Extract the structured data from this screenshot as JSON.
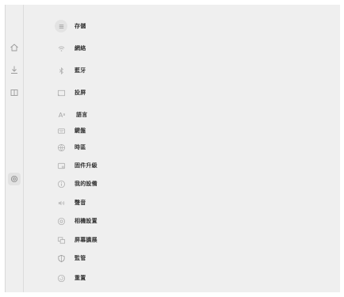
{
  "rail": [
    {
      "icon": "home-icon",
      "active": false
    },
    {
      "icon": "download-icon",
      "active": false
    },
    {
      "icon": "tablet-icon",
      "active": false
    },
    {
      "icon": "gear-icon",
      "active": true
    }
  ],
  "menu": {
    "items": [
      {
        "label": "存儲",
        "icon": "storage-icon"
      },
      {
        "label": "網絡",
        "icon": "wifi-icon"
      },
      {
        "label": "藍牙",
        "icon": "bluetooth-icon"
      },
      {
        "label": "投屏",
        "icon": "screen-cast-icon"
      },
      {
        "label": "語言",
        "icon": "language-icon"
      },
      {
        "label": "鍵盤",
        "icon": "keyboard-icon"
      },
      {
        "label": "時區",
        "icon": "globe-icon"
      },
      {
        "label": "固件升級",
        "icon": "firmware-update-icon"
      },
      {
        "label": "我的設備",
        "icon": "info-icon"
      },
      {
        "label": "聲音",
        "icon": "volume-icon"
      },
      {
        "label": "相機設置",
        "icon": "camera-icon"
      },
      {
        "label": "屏幕擴展",
        "icon": "screen-extend-icon"
      },
      {
        "label": "監管",
        "icon": "shield-icon"
      },
      {
        "label": "重置",
        "icon": "reset-icon"
      }
    ]
  }
}
